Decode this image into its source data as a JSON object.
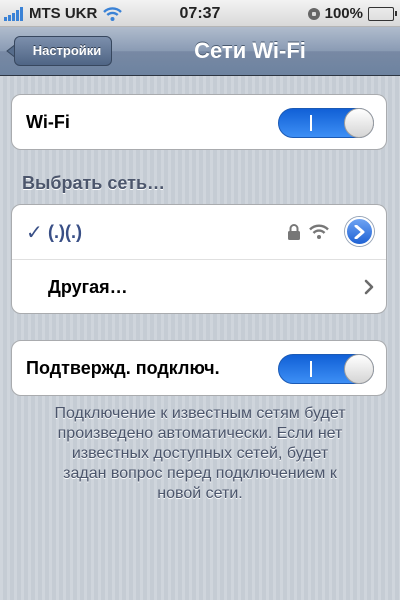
{
  "status_bar": {
    "carrier": "MTS UKR",
    "time": "07:37",
    "battery": "100%"
  },
  "nav": {
    "back_label": "Настройки",
    "title": "Сети Wi-Fi"
  },
  "wifi_row": {
    "label": "Wi-Fi",
    "enabled": true
  },
  "section_header": "Выбрать сеть…",
  "networks": [
    {
      "name": "(.)(.)",
      "selected": true,
      "secured": true
    }
  ],
  "other_label": "Другая…",
  "ask_row": {
    "label": "Подтвержд. подключ.",
    "enabled": true
  },
  "footer": {
    "lines": [
      "Подключение к известным сетям будет",
      "произведено автоматически. Если нет",
      "известных доступных сетей, будет",
      "задан вопрос перед подключением к",
      "новой сети."
    ]
  },
  "colors": {
    "accent_blue": "#1f62d4",
    "selected_text": "#394f86",
    "nav_bar": "#7889a4"
  }
}
